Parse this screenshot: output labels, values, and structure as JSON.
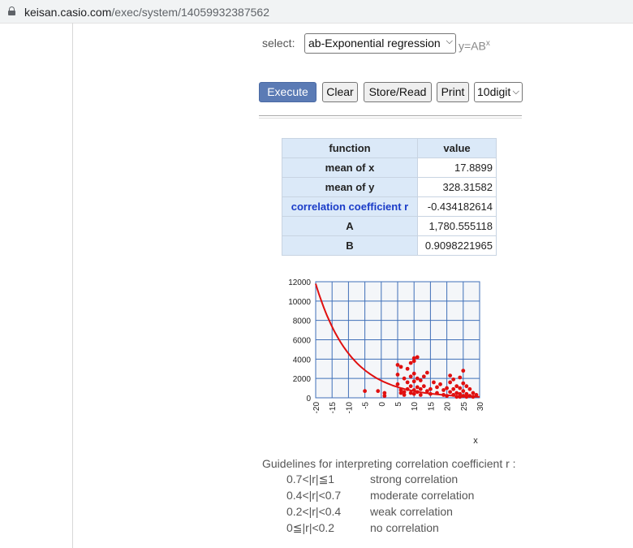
{
  "browser": {
    "url_host": "keisan.casio.com",
    "url_path": "/exec/system/14059932387562"
  },
  "form": {
    "select_label": "select:",
    "regression_option": "ab-Exponential regression",
    "formula_base": "y=AB",
    "formula_exp": "x"
  },
  "buttons": {
    "execute": "Execute",
    "clear": "Clear",
    "store_read": "Store/Read",
    "print": "Print",
    "digits": "10digit"
  },
  "results": {
    "header_function": "function",
    "header_value": "value",
    "rows": [
      {
        "label": "mean of x",
        "value": "17.8899"
      },
      {
        "label": "mean of y",
        "value": "328.31582"
      },
      {
        "label": "correlation coefficient r",
        "value": "-0.434182614"
      },
      {
        "label": "A",
        "value": "1,780.555118"
      },
      {
        "label": "B",
        "value": "0.9098221965"
      }
    ]
  },
  "chart_data": {
    "type": "scatter",
    "xlabel": "x",
    "ylabel": "",
    "xlim": [
      -20,
      30
    ],
    "ylim": [
      0,
      12000
    ],
    "x_ticks": [
      "-20",
      "-15",
      "-10",
      "-5",
      "0",
      "5",
      "10",
      "15",
      "20",
      "25",
      "30"
    ],
    "y_ticks": [
      "0",
      "2000",
      "4000",
      "6000",
      "8000",
      "10000",
      "12000"
    ],
    "grid": true,
    "curve": {
      "A": 1780.555118,
      "B": 0.9098221965,
      "color": "#e01010"
    },
    "point_color": "#e01010",
    "points": [
      [
        -5,
        700
      ],
      [
        -1,
        700
      ],
      [
        1,
        500
      ],
      [
        1,
        200
      ],
      [
        5,
        3400
      ],
      [
        5,
        2400
      ],
      [
        5,
        1400
      ],
      [
        6,
        3200
      ],
      [
        6,
        800
      ],
      [
        6,
        500
      ],
      [
        7,
        2000
      ],
      [
        7,
        600
      ],
      [
        7,
        300
      ],
      [
        8,
        3000
      ],
      [
        8,
        1600
      ],
      [
        8,
        900
      ],
      [
        9,
        3600
      ],
      [
        9,
        2200
      ],
      [
        9,
        1200
      ],
      [
        9,
        500
      ],
      [
        10,
        4100
      ],
      [
        10,
        3800
      ],
      [
        10,
        2500
      ],
      [
        10,
        1700
      ],
      [
        10,
        800
      ],
      [
        10,
        400
      ],
      [
        11,
        4200
      ],
      [
        11,
        2000
      ],
      [
        11,
        1100
      ],
      [
        11,
        600
      ],
      [
        12,
        1800
      ],
      [
        12,
        900
      ],
      [
        12,
        300
      ],
      [
        13,
        2200
      ],
      [
        13,
        1200
      ],
      [
        14,
        2600
      ],
      [
        14,
        700
      ],
      [
        15,
        900
      ],
      [
        15,
        400
      ],
      [
        16,
        1600
      ],
      [
        17,
        1100
      ],
      [
        17,
        500
      ],
      [
        18,
        1400
      ],
      [
        19,
        800
      ],
      [
        19,
        300
      ],
      [
        20,
        1000
      ],
      [
        21,
        2300
      ],
      [
        21,
        1600
      ],
      [
        21,
        600
      ],
      [
        22,
        1900
      ],
      [
        22,
        900
      ],
      [
        22,
        300
      ],
      [
        23,
        1200
      ],
      [
        23,
        500
      ],
      [
        24,
        2100
      ],
      [
        24,
        1000
      ],
      [
        24,
        400
      ],
      [
        25,
        2800
      ],
      [
        25,
        1500
      ],
      [
        25,
        700
      ],
      [
        25,
        200
      ],
      [
        26,
        1200
      ],
      [
        26,
        400
      ],
      [
        27,
        900
      ],
      [
        27,
        200
      ],
      [
        28,
        500
      ],
      [
        28,
        100
      ],
      [
        29,
        300
      ],
      [
        26,
        100
      ],
      [
        24,
        100
      ],
      [
        20,
        200
      ],
      [
        23,
        100
      ]
    ]
  },
  "guidelines": {
    "title": "Guidelines for interpreting correlation coefficient r :",
    "items": [
      {
        "range": "0.7<|r|≦1",
        "desc": "strong correlation"
      },
      {
        "range": "0.4<|r|<0.7",
        "desc": "moderate correlation"
      },
      {
        "range": "0.2<|r|<0.4",
        "desc": "weak correlation"
      },
      {
        "range": "0≦|r|<0.2",
        "desc": " no correlation"
      }
    ]
  }
}
